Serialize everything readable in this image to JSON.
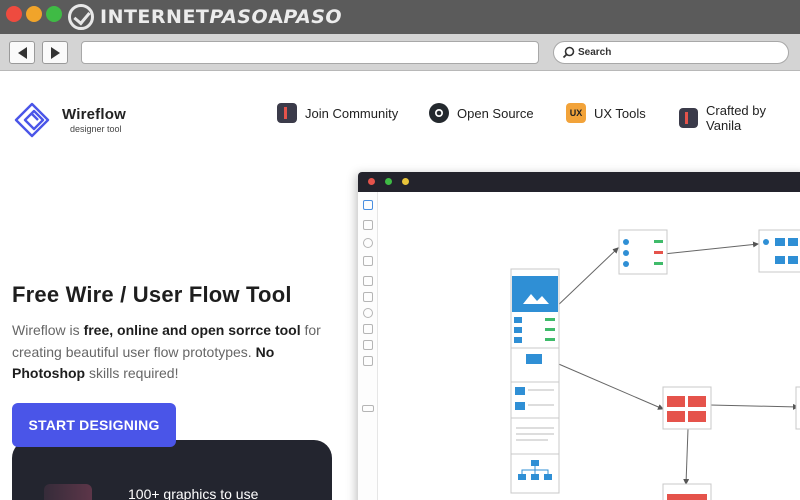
{
  "browser": {
    "watermark": {
      "part1": "INTERNET",
      "part2": "PASO",
      "part3": "A",
      "part4": "PASO"
    },
    "search_placeholder": "Search"
  },
  "site": {
    "brand": {
      "name": "Wireflow",
      "tagline": "designer tool"
    },
    "menu": [
      {
        "label": "Join Community",
        "icon": "community-icon"
      },
      {
        "label": "Open Source",
        "icon": "github-icon"
      },
      {
        "label": "UX Tools",
        "icon": "ux-tools-icon",
        "badge": "UX"
      },
      {
        "label": "Crafted by Vanila",
        "icon": "vanila-icon"
      }
    ]
  },
  "hero": {
    "title": "Free Wire / User Flow Tool",
    "desc_1": "Wireflow is ",
    "desc_2": "free, online and open sorrce tool",
    "desc_3": " for creating beautiful user flow prototypes. ",
    "desc_4": "No Photoshop",
    "desc_5": " skills required!",
    "cta": "START DESIGNING",
    "card_text": "100+ graphics to use"
  },
  "colors": {
    "accent": "#4a55e8",
    "app_bar": "#23232c",
    "diagram_blue": "#2f8fd5",
    "diagram_red": "#e5534b",
    "diagram_green": "#3fbb6a"
  }
}
